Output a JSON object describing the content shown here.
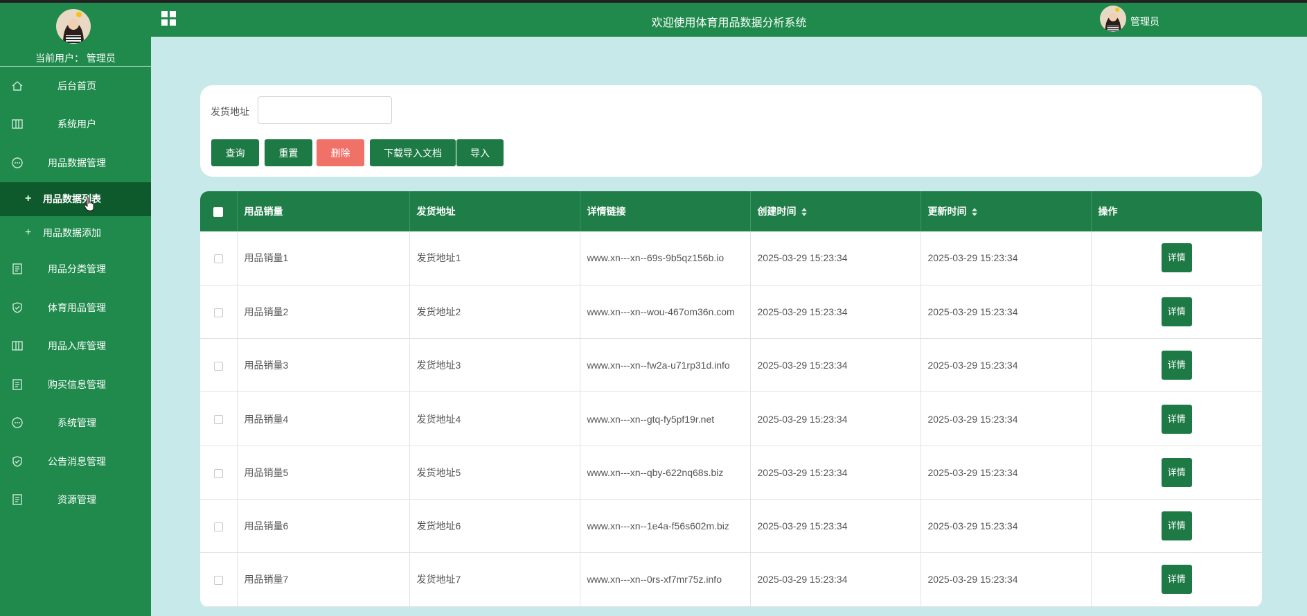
{
  "sidebar": {
    "current_user": "当前用户： 管理员",
    "items": [
      {
        "label": "后台首页",
        "icon": "home-icon"
      },
      {
        "label": "系统用户",
        "icon": "columns-icon"
      },
      {
        "label": "用品数据管理",
        "icon": "chat-bubble-icon"
      },
      {
        "label": "用品数据列表",
        "icon": "plus-icon",
        "sub": true,
        "active": true
      },
      {
        "label": "用品数据添加",
        "icon": "plus-icon",
        "sub": true
      },
      {
        "label": "用品分类管理",
        "icon": "document-icon"
      },
      {
        "label": "体育用品管理",
        "icon": "shield-check-icon"
      },
      {
        "label": "用品入库管理",
        "icon": "columns-icon"
      },
      {
        "label": "购买信息管理",
        "icon": "document-icon"
      },
      {
        "label": "系统管理",
        "icon": "chat-bubble-icon"
      },
      {
        "label": "公告消息管理",
        "icon": "shield-check-icon"
      },
      {
        "label": "资源管理",
        "icon": "document-icon"
      }
    ]
  },
  "header": {
    "title": "欢迎使用体育用品数据分析系统",
    "user": "管理员"
  },
  "search": {
    "label": "发货地址",
    "value": "",
    "buttons": {
      "query": "查询",
      "reset": "重置",
      "delete": "删除",
      "download": "下载导入文档",
      "import": "导入"
    }
  },
  "table": {
    "columns": [
      "用品销量",
      "发货地址",
      "详情链接",
      "创建时间",
      "更新时间",
      "操作"
    ],
    "detail_label": "详情",
    "rows": [
      [
        "用品销量1",
        "发货地址1",
        "www.xn---xn--69s-9b5qz156b.io",
        "2025-03-29 15:23:34",
        "2025-03-29 15:23:34"
      ],
      [
        "用品销量2",
        "发货地址2",
        "www.xn---xn--wou-467om36n.com",
        "2025-03-29 15:23:34",
        "2025-03-29 15:23:34"
      ],
      [
        "用品销量3",
        "发货地址3",
        "www.xn---xn--fw2a-u71rp31d.info",
        "2025-03-29 15:23:34",
        "2025-03-29 15:23:34"
      ],
      [
        "用品销量4",
        "发货地址4",
        "www.xn---xn--gtq-fy5pf19r.net",
        "2025-03-29 15:23:34",
        "2025-03-29 15:23:34"
      ],
      [
        "用品销量5",
        "发货地址5",
        "www.xn---xn--qby-622nq68s.biz",
        "2025-03-29 15:23:34",
        "2025-03-29 15:23:34"
      ],
      [
        "用品销量6",
        "发货地址6",
        "www.xn---xn--1e4a-f56s602m.biz",
        "2025-03-29 15:23:34",
        "2025-03-29 15:23:34"
      ],
      [
        "用品销量7",
        "发货地址7",
        "www.xn---xn--0rs-xf7mr75z.info",
        "2025-03-29 15:23:34",
        "2025-03-29 15:23:34"
      ]
    ]
  },
  "colors": {
    "sidebar": "#1f8a4c",
    "active": "#0f5a2c",
    "button": "#1e7a45",
    "danger": "#f07168",
    "background": "#c8e9e9"
  }
}
